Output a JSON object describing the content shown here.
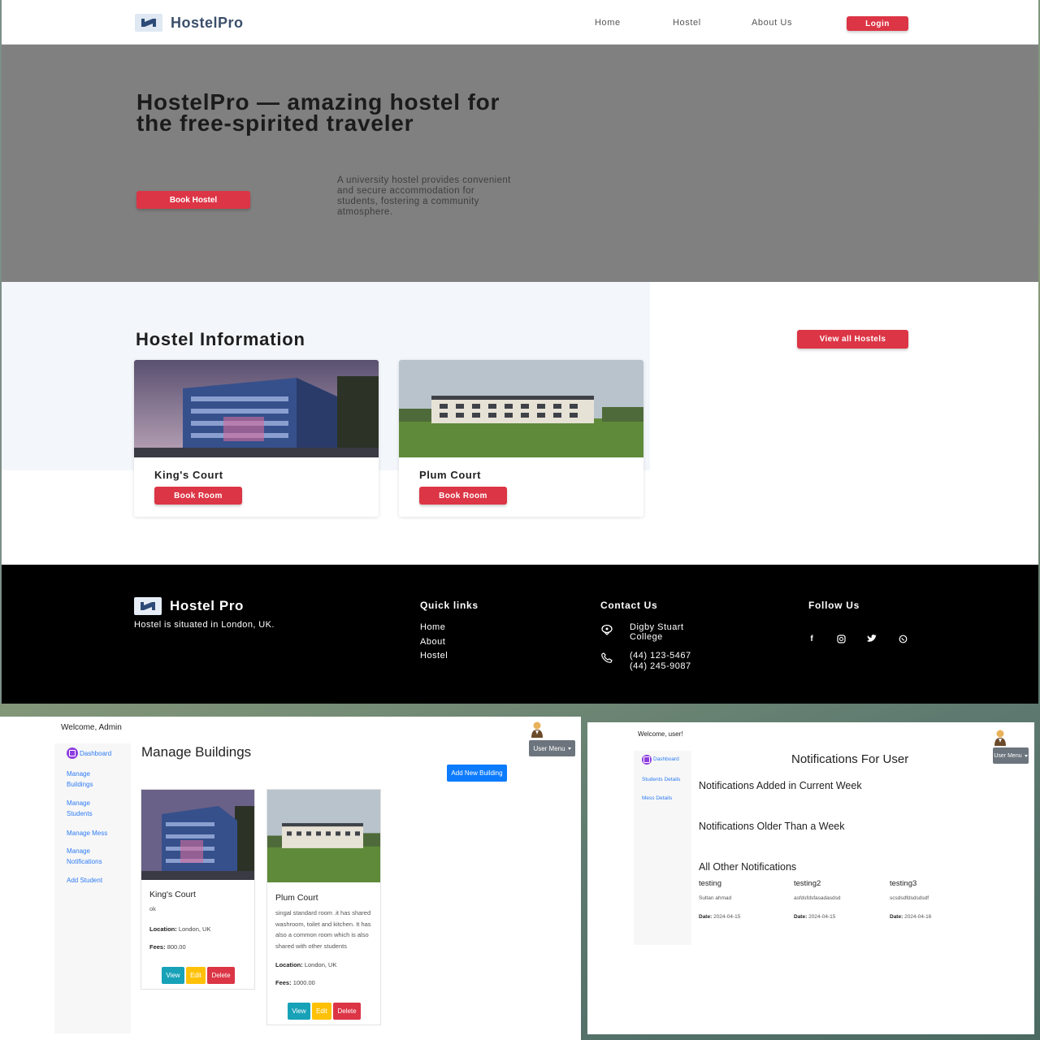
{
  "site": {
    "brand": "HostelPro",
    "nav": [
      "Home",
      "Hostel",
      "About Us"
    ],
    "login": "Login",
    "hero_title": "HostelPro — amazing hostel for the free-spirited traveler",
    "hero_description": "A university hostel provides convenient and secure accommodation for students, fostering a community atmosphere.",
    "book_hostel": "Book Hostel",
    "info_title": "Hostel Information",
    "view_all": "View all Hostels",
    "hostels": [
      {
        "name": "King's Court",
        "button": "Book Room"
      },
      {
        "name": "Plum Court",
        "button": "Book Room"
      }
    ],
    "footer": {
      "brand": "Hostel Pro",
      "tagline": "Hostel is situated in London, UK.",
      "quick_links_title": "Quick links",
      "quick_links": [
        "Home",
        "About",
        "Hostel"
      ],
      "contact_title": "Contact Us",
      "address": "Digby Stuart College",
      "phone1": "(44) 123-5467",
      "phone2": "(44) 245-9087",
      "follow_title": "Follow Us",
      "social_icons": [
        "facebook-icon",
        "instagram-icon",
        "twitter-icon",
        "whatsapp-icon"
      ]
    }
  },
  "admin": {
    "welcome": "Welcome, Admin",
    "sidebar": [
      "Dashboard",
      "Manage Buildings",
      "Manage Students",
      "Manage Mess",
      "Manage Notifications",
      "Add Student"
    ],
    "user_menu": "User Menu",
    "title": "Manage Buildings",
    "add_button": "Add New Building",
    "location_label": "Location:",
    "fees_label": "Fees:",
    "buildings": [
      {
        "name": "King's Court",
        "description": "ok",
        "location": "London, UK",
        "fees": "800.00"
      },
      {
        "name": "Plum Court",
        "description": "singal standard room .it has shared washroom, toilet and kitchen. It has also a common room which is also shared with other students",
        "location": "London, UK",
        "fees": "1000.00"
      }
    ],
    "actions": {
      "view": "View",
      "edit": "Edit",
      "delete": "Delete"
    }
  },
  "user": {
    "welcome": "Welcome, user!",
    "sidebar": [
      "Dashboard",
      "Students Details",
      "Mess Details"
    ],
    "user_menu": "User Menu",
    "title": "Notifications For User",
    "current_week": "Notifications Added in Current Week",
    "older": "Notifications Older Than a Week",
    "all_other": "All Other Notifications",
    "date_label": "Date:",
    "notifications": [
      {
        "title": "testing",
        "message": "Sultan ahmad",
        "date": "2024-04-15"
      },
      {
        "title": "testing2",
        "message": "asfdsfdsfasadasdsd",
        "date": "2024-04-15"
      },
      {
        "title": "testing3",
        "message": "scsdsdfdsdsdsdf",
        "date": "2024-04-16"
      }
    ]
  },
  "colors": {
    "brand_red": "#dc3545",
    "primary_blue": "#0d7bfd",
    "info_teal": "#17a2b8",
    "warning_yellow": "#ffc107",
    "hero_gray": "#808080"
  }
}
